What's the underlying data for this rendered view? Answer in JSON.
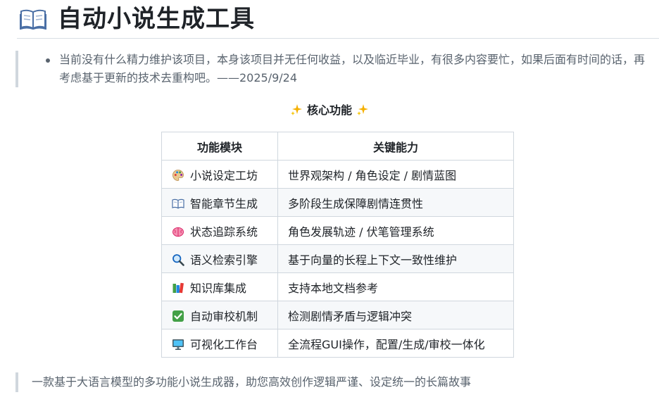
{
  "header": {
    "title": "自动小说生成工具",
    "icon": "open-book-icon"
  },
  "notice": {
    "items": [
      "当前没有什么精力维护该项目，本身该项目并无任何收益，以及临近毕业，有很多内容要忙，如果后面有时间的话，再考虑基于更新的技术去重构吧。——2025/9/24"
    ]
  },
  "core": {
    "heading": "核心功能",
    "heading_icon": "sparkles-icon",
    "columns": [
      "功能模块",
      "关键能力"
    ],
    "rows": [
      {
        "icon": "palette-icon",
        "module": "小说设定工坊",
        "capability": "世界观架构 / 角色设定 / 剧情蓝图"
      },
      {
        "icon": "open-book-icon",
        "module": "智能章节生成",
        "capability": "多阶段生成保障剧情连贯性"
      },
      {
        "icon": "brain-icon",
        "module": "状态追踪系统",
        "capability": "角色发展轨迹 / 伏笔管理系统"
      },
      {
        "icon": "magnifier-icon",
        "module": "语义检索引擎",
        "capability": "基于向量的长程上下文一致性维护"
      },
      {
        "icon": "books-icon",
        "module": "知识库集成",
        "capability": "支持本地文档参考"
      },
      {
        "icon": "check-mark-icon",
        "module": "自动审校机制",
        "capability": "检测剧情矛盾与逻辑冲突"
      },
      {
        "icon": "monitor-icon",
        "module": "可视化工作台",
        "capability": "全流程GUI操作，配置/生成/审校一体化"
      }
    ]
  },
  "footer": {
    "tagline": "一款基于大语言模型的多功能小说生成器，助您高效创作逻辑严谨、设定统一的长篇故事"
  },
  "colors": {
    "text": "#1f2328",
    "muted": "#59636e",
    "border": "#d0d7de",
    "row_alt": "#f6f8fa"
  }
}
